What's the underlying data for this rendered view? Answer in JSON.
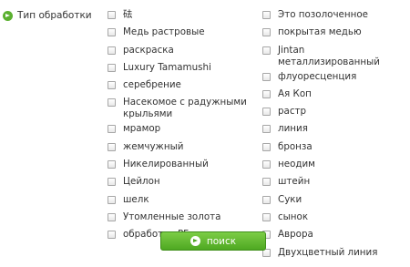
{
  "filter": {
    "label": "Тип обработки",
    "left_options": [
      "砝",
      "Медь растровые",
      "раскраска",
      "Luxury Tamamushi",
      "серебрение",
      "Насекомое с радужными крыльями",
      "мрамор",
      "жемчужный",
      "Никелированный",
      "Цейлон",
      "шелк",
      "Утомленные золота",
      "обработка PF"
    ],
    "right_options": [
      "Это позолоченное",
      "покрытая медью",
      "Jintan металлизированный",
      "флуоресценция",
      "Ая Коп",
      "растр",
      "линия",
      "бронза",
      "неодим",
      "штейн",
      "Суки",
      "сынок",
      "Аврора",
      "Двухцветный линия"
    ]
  },
  "search_button": {
    "label": "поиск"
  },
  "colors": {
    "accent": "#5bb030",
    "button": "#4ea821"
  }
}
